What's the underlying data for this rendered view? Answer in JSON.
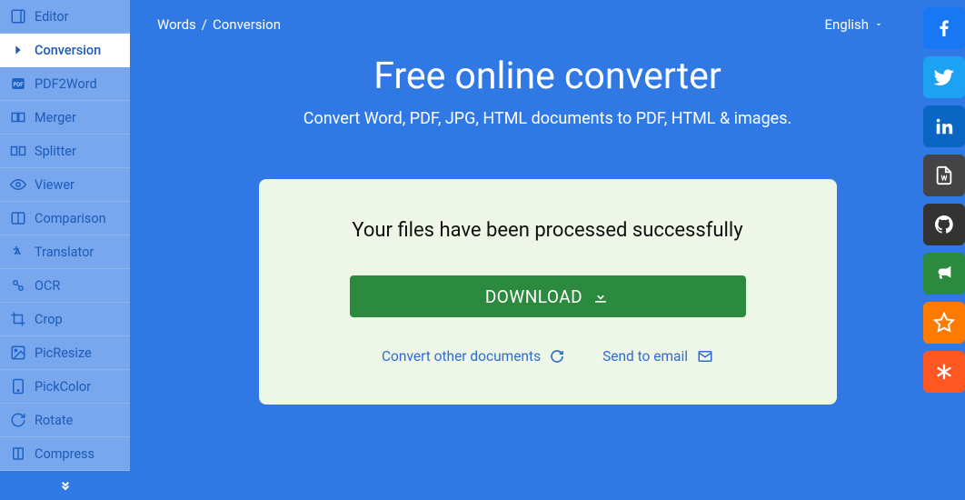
{
  "breadcrumb": {
    "root": "Words",
    "current": "Conversion"
  },
  "language": "English",
  "headline": "Free online converter",
  "subline": "Convert Word, PDF, JPG, HTML documents to PDF, HTML & images.",
  "card": {
    "success_msg": "Your files have been processed successfully",
    "download_label": "DOWNLOAD",
    "convert_other": "Convert other documents",
    "send_email": "Send to email"
  },
  "sidebar": {
    "items": [
      {
        "label": "Editor"
      },
      {
        "label": "Conversion"
      },
      {
        "label": "PDF2Word"
      },
      {
        "label": "Merger"
      },
      {
        "label": "Splitter"
      },
      {
        "label": "Viewer"
      },
      {
        "label": "Comparison"
      },
      {
        "label": "Translator"
      },
      {
        "label": "OCR"
      },
      {
        "label": "Crop"
      },
      {
        "label": "PicResize"
      },
      {
        "label": "PickColor"
      },
      {
        "label": "Rotate"
      },
      {
        "label": "Compress"
      }
    ]
  }
}
